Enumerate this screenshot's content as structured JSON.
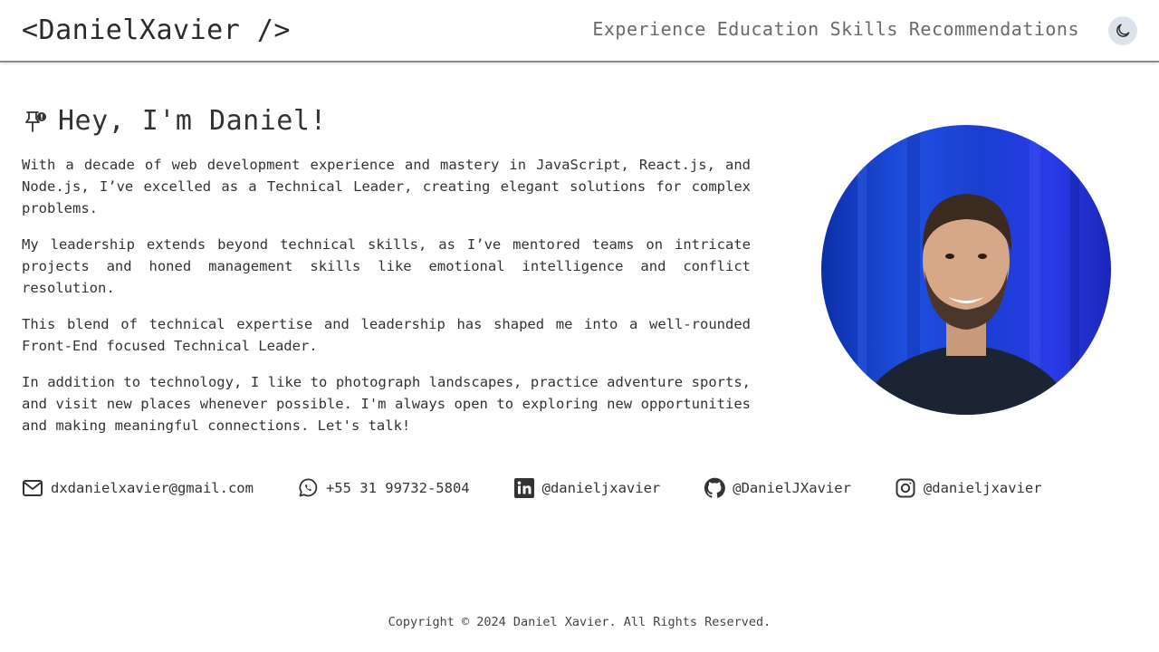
{
  "header": {
    "logo": "<DanielXavier />",
    "nav": [
      "Experience",
      "Education",
      "Skills",
      "Recommendations"
    ],
    "theme_icon": "moon-icon"
  },
  "hero": {
    "title": "Hey, I'm Daniel!",
    "title_icon": "pin-icon",
    "paragraphs": [
      "With a decade of web development experience and mastery in JavaScript, React.js, and Node.js, I’ve excelled as a Technical Leader, creating elegant solutions for complex problems.",
      "My leadership extends beyond technical skills, as I’ve mentored teams on intricate projects and honed management skills like emotional intelligence and conflict resolution.",
      "This blend of technical expertise and leadership has shaped me into a well-rounded Front-End focused Technical Leader.",
      "In addition to technology, I like to photograph landscapes, practice adventure sports, and visit new places whenever possible. I'm always open to exploring new opportunities and making meaningful connections. Let's talk!"
    ]
  },
  "contacts": [
    {
      "icon": "email-icon",
      "text": "dxdanielxavier@gmail.com"
    },
    {
      "icon": "whatsapp-icon",
      "text": "+55 31 99732-5804"
    },
    {
      "icon": "linkedin-icon",
      "text": "@danieljxavier"
    },
    {
      "icon": "github-icon",
      "text": "@DanielJXavier"
    },
    {
      "icon": "instagram-icon",
      "text": "@danieljxavier"
    }
  ],
  "footer": {
    "copyright": "Copyright © 2024 Daniel Xavier. All Rights Reserved."
  },
  "colors": {
    "text": "#333333",
    "nav": "#6a6a6a",
    "theme_button_bg": "#dde3ea",
    "photo_bg": "#1836c8"
  }
}
